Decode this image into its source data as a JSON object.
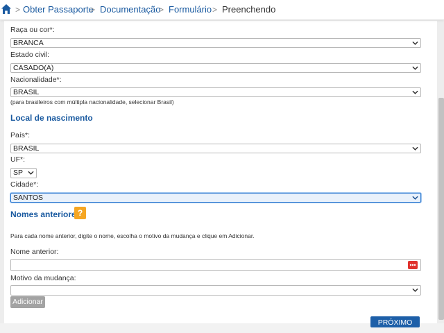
{
  "breadcrumb": {
    "home_icon": "home-icon",
    "items": [
      "Obter Passaporte",
      "Documentação",
      "Formulário",
      "Preenchendo"
    ],
    "separator": ">"
  },
  "form": {
    "raca": {
      "label": "Raça ou cor*:",
      "value": "BRANCA"
    },
    "estado_civil": {
      "label": "Estado civil:",
      "value": "CASADO(A)"
    },
    "nacionalidade": {
      "label": "Nacionalidade*:",
      "value": "BRASIL",
      "hint": "(para brasileiros com múltipla nacionalidade, selecionar Brasil)"
    },
    "local_nascimento": {
      "title": "Local de nascimento",
      "pais": {
        "label": "País*:",
        "value": "BRASIL"
      },
      "uf": {
        "label": "UF*:",
        "value": "SP"
      },
      "cidade": {
        "label": "Cidade*:",
        "value": "SANTOS"
      }
    },
    "nomes_anteriores": {
      "title": "Nomes anteriores",
      "help_symbol": "?",
      "instructions": "Para cada nome anterior, digite o nome, escolha o motivo da mudança e clique em Adicionar.",
      "nome_anterior": {
        "label": "Nome anterior:",
        "value": ""
      },
      "motivo": {
        "label": "Motivo da mudança:",
        "value": ""
      },
      "add_label": "Adicionar"
    },
    "next_label": "PRÓXIMO"
  },
  "colors": {
    "link_blue": "#1a5aa0",
    "primary_button": "#1d5fa8",
    "help_orange": "#f5a623",
    "disabled_button": "#a3a3a3",
    "focus_border": "#2f7ad0"
  }
}
